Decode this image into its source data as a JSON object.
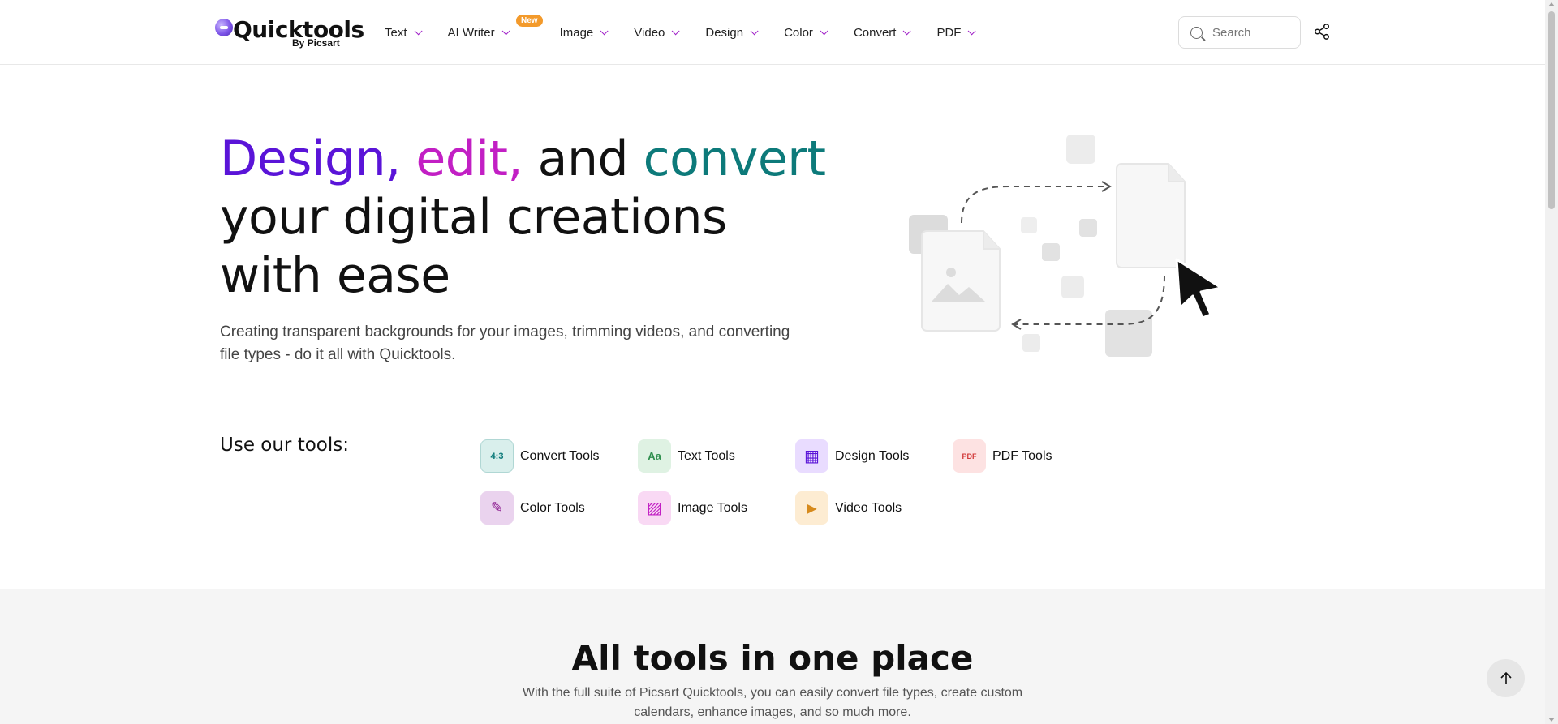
{
  "brand": {
    "name": "Quicktools",
    "sub": "By Picsart"
  },
  "nav": [
    {
      "label": "Text"
    },
    {
      "label": "AI Writer",
      "badge": "New"
    },
    {
      "label": "Image"
    },
    {
      "label": "Video"
    },
    {
      "label": "Design"
    },
    {
      "label": "Color"
    },
    {
      "label": "Convert"
    },
    {
      "label": "PDF"
    }
  ],
  "search": {
    "placeholder": "Search"
  },
  "hero": {
    "title_design": "Design,",
    "title_edit": "edit,",
    "title_and": "and",
    "title_convert": "convert",
    "title_line2": "your digital creations",
    "title_line3": "with ease",
    "description": "Creating transparent backgrounds for your images, trimming videos, and converting file types - do it all with Quicktools."
  },
  "tools": {
    "label": "Use our tools:",
    "items": [
      {
        "label": "Convert Tools",
        "icon": "convert-icon",
        "glyph": "4:3",
        "bg": "#d9efec",
        "fg": "#0d7a7a"
      },
      {
        "label": "Text Tools",
        "icon": "text-icon",
        "glyph": "Aa",
        "bg": "#dff2e3",
        "fg": "#2f8f4e"
      },
      {
        "label": "Design Tools",
        "icon": "design-grid-icon",
        "glyph": "▦",
        "bg": "#e9dcff",
        "fg": "#5a14d8"
      },
      {
        "label": "PDF Tools",
        "icon": "pdf-icon",
        "glyph": "PDF",
        "bg": "#fde2e2",
        "fg": "#d23a3a"
      },
      {
        "label": "Color Tools",
        "icon": "color-picker-icon",
        "glyph": "✎",
        "bg": "#ead3ee",
        "fg": "#8a1a8e"
      },
      {
        "label": "Image Tools",
        "icon": "image-icon",
        "glyph": "▨",
        "bg": "#f9d9f4",
        "fg": "#c21fc4"
      },
      {
        "label": "Video Tools",
        "icon": "video-icon",
        "glyph": "▶",
        "bg": "#fdecd2",
        "fg": "#d68a1c"
      }
    ]
  },
  "all_tools": {
    "title": "All tools in one place",
    "description": "With the full suite of Picsart Quicktools, you can easily convert file types, create custom calendars, enhance images, and so much more."
  }
}
